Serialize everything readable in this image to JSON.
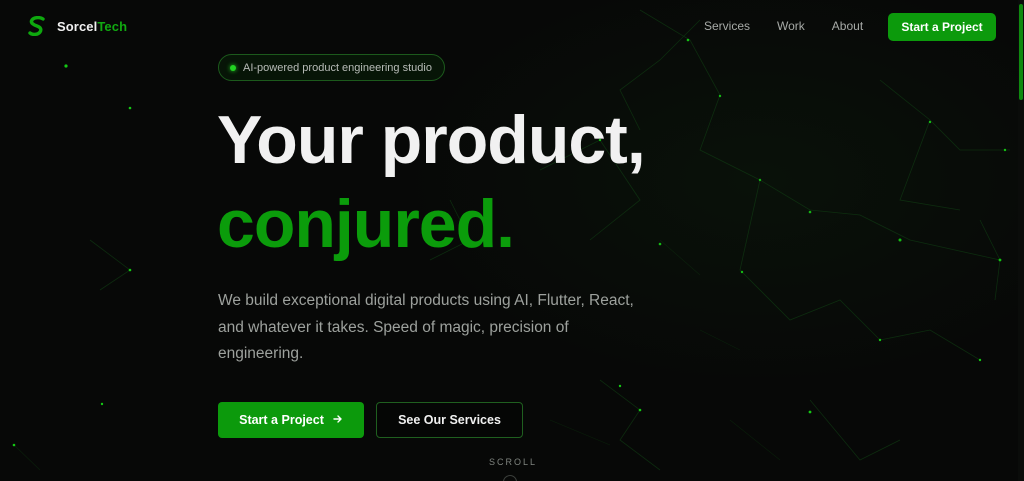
{
  "brand": {
    "name_part1": "Sorcel",
    "name_part2": "Tech",
    "logo_icon": "sorcel-s-logo-icon",
    "accent_color": "#0c9a0c"
  },
  "nav": {
    "items": [
      "Services",
      "Work",
      "About"
    ],
    "cta": "Start a Project"
  },
  "hero": {
    "badge": "AI-powered product engineering studio",
    "headline_line1": "Your product,",
    "headline_line2": "conjured.",
    "description": "We build exceptional digital products using AI, Flutter, React, and whatever it takes. Speed of magic, precision of engineering.",
    "primary_button": "Start a Project",
    "primary_button_icon": "arrow-right-icon",
    "secondary_button": "See Our Services",
    "scroll_label": "SCROLL"
  }
}
